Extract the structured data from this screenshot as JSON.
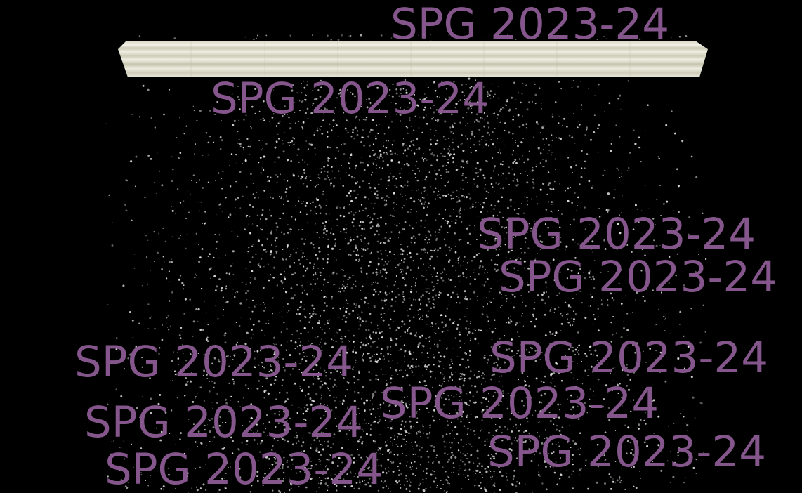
{
  "scene": {
    "background_color": "#000000",
    "particle_color": "#e8e8e8",
    "bar_color": "#e6e4d3",
    "watermark_color": "#8a5a91"
  },
  "watermarks": [
    "SPG 2023-24",
    "SPG 2023-24",
    "SPG 2023-24",
    "SPG 2023-24",
    "SPG 2023-24",
    "SPG 2023-24",
    "SPG 2023-24",
    "SPG 2023-24",
    "SPG 2023-24",
    "SPG 2023-24"
  ]
}
